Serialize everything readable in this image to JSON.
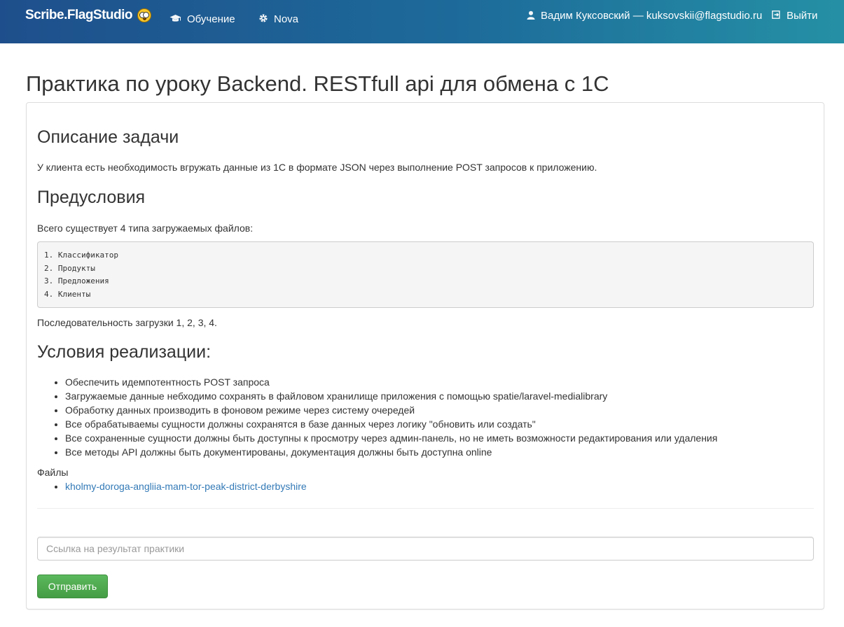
{
  "navbar": {
    "brand": "Scribe.FlagStudio",
    "items": [
      {
        "label": "Обучение",
        "icon": "graduation-cap-icon"
      },
      {
        "label": "Nova",
        "icon": "gear-icon"
      }
    ],
    "user": {
      "label": "Вадим Куксовский — kuksovskii@flagstudio.ru",
      "icon": "user-icon"
    },
    "logout": {
      "label": "Выйти",
      "icon": "sign-out-icon"
    },
    "colors": {
      "gradient_start": "#1e4f8c",
      "gradient_end": "#2590a5"
    }
  },
  "page": {
    "title": "Практика по уроку Backend. RESTfull api для обмена с 1С"
  },
  "task": {
    "description_heading": "Описание задачи",
    "description_text": "У клиента есть необходимость вгружать данные из 1С в формате JSON через выполнение POST запросов к приложению.",
    "preconditions_heading": "Предусловия",
    "preconditions_intro": "Всего существует 4 типа загружаемых файлов:",
    "file_types": [
      "1. Классификатор",
      "2. Продукты",
      "3. Предложения",
      "4. Клиенты"
    ],
    "sequence_text": "Последовательность загрузки 1, 2, 3, 4.",
    "conditions_heading": "Условия реализации:",
    "conditions": [
      "Обеспечить идемпотентность POST запроса",
      "Загружаемые данные небходимо сохранять в файловом хранилище приложения с помощью spatie/laravel-medialibrary",
      "Обработку данных производить в фоновом режиме через систему очередей",
      "Все обрабатываемы сущности должны сохранятся в базе данных через логику \"обновить или создать\"",
      "Все сохраненные сущности должны быть доступны к просмотру через админ-панель, но не иметь возможности редактирования или удаления",
      "Все методы API должны быть документированы, документация должны быть доступна online"
    ],
    "files_label": "Файлы",
    "files": [
      "kholmy-doroga-angliia-mam-tor-peak-district-derbyshire"
    ]
  },
  "form": {
    "result_placeholder": "Ссылка на результат практики",
    "result_value": "",
    "submit_label": "Отправить",
    "submit_color": "#5cb85c",
    "link_color": "#337ab7"
  }
}
